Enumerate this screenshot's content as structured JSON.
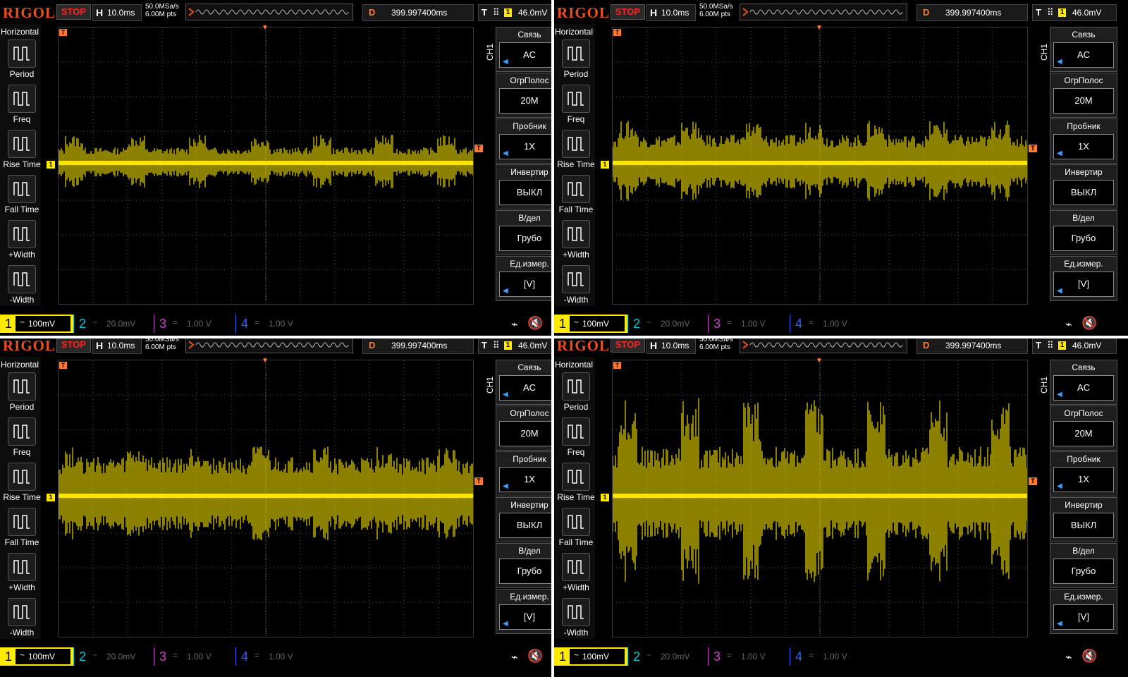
{
  "header": {
    "brand": "RIGOL",
    "run_state": "STOP",
    "h_label": "H",
    "timebase": "10.0ms",
    "sample_rate": "50.0MSa/s",
    "mem_depth": "6.00M pts",
    "d_label": "D",
    "delay": "399.997400ms",
    "t_label": "T",
    "trigger_source": "1",
    "trigger_level": "46.0mV"
  },
  "left_menu": {
    "title": "Horizontal",
    "items": [
      {
        "label": "Period",
        "icon": "period-icon"
      },
      {
        "label": "Freq",
        "icon": "freq-icon"
      },
      {
        "label": "Rise Time",
        "icon": "rise-time-icon"
      },
      {
        "label": "Fall Time",
        "icon": "fall-time-icon"
      },
      {
        "label": "+Width",
        "icon": "positive-width-icon"
      },
      {
        "label": "-Width",
        "icon": "negative-width-icon"
      }
    ]
  },
  "right_menu": {
    "channel": "CH1",
    "items": [
      {
        "title": "Связь",
        "value": "AC",
        "arrow": true
      },
      {
        "title": "ОгрПолос",
        "value": "20M",
        "arrow": false
      },
      {
        "title": "Пробник",
        "value": "1X",
        "arrow": true
      },
      {
        "title": "Инвертир",
        "value": "ВЫКЛ",
        "arrow": false
      },
      {
        "title": "В/дел",
        "value": "Грубо",
        "arrow": false
      },
      {
        "title": "Ед.измер.",
        "value": "[V]",
        "arrow": true
      }
    ]
  },
  "channels": [
    {
      "num": "1",
      "coupling": "~",
      "scale": "100mV",
      "color": "#ffea00",
      "active": true
    },
    {
      "num": "2",
      "coupling": "~",
      "scale": "20.0mV",
      "color": "#00c8d8",
      "active": false
    },
    {
      "num": "3",
      "coupling": "=",
      "scale": "1.00 V",
      "color": "#d040d0",
      "active": false
    },
    {
      "num": "4",
      "coupling": "=",
      "scale": "1.00 V",
      "color": "#3060ff",
      "active": false
    }
  ],
  "status_icons": [
    "usb-icon",
    "speaker-muted-icon"
  ],
  "trace_color": "#ffea00",
  "panels": [
    {
      "id": "top-left",
      "signal_level": "low"
    },
    {
      "id": "top-right",
      "signal_level": "medium"
    },
    {
      "id": "bottom-left",
      "signal_level": "medium-high"
    },
    {
      "id": "bottom-right",
      "signal_level": "high"
    }
  ]
}
